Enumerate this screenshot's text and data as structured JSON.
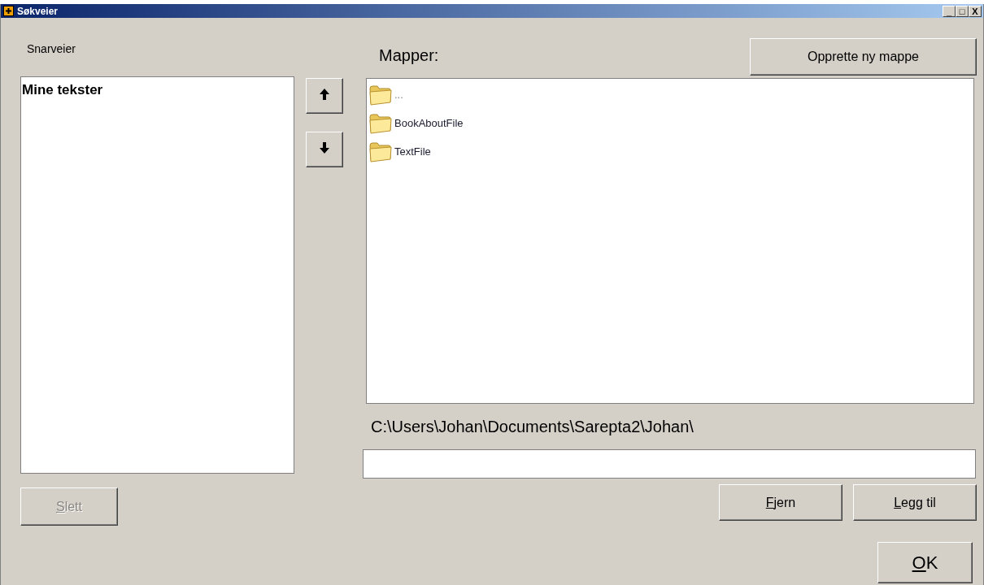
{
  "window": {
    "title": "Søkveier",
    "controls": [
      "_",
      "□",
      "X"
    ]
  },
  "shortcuts": {
    "label": "Snarveier",
    "items": [
      {
        "name": "Mine tekster",
        "selected": false
      }
    ],
    "delete_button": {
      "label": "Slett",
      "disabled": true
    }
  },
  "move_buttons": [
    {
      "kind": "up"
    },
    {
      "kind": "down"
    }
  ],
  "folders": {
    "label": "Mapper:",
    "create_button": "Opprette ny mappe",
    "items": [
      {
        "name": "..."
      },
      {
        "name": "BookAboutFile"
      },
      {
        "name": "TextFile"
      }
    ],
    "path": "C:\\Users\\Johan\\Documents\\Sarepta2\\Johan\\"
  },
  "buttons": [
    {
      "label": "Fjern",
      "disabled": false
    },
    {
      "label": "Legg til",
      "disabled": false
    }
  ],
  "ok_button": "OK"
}
